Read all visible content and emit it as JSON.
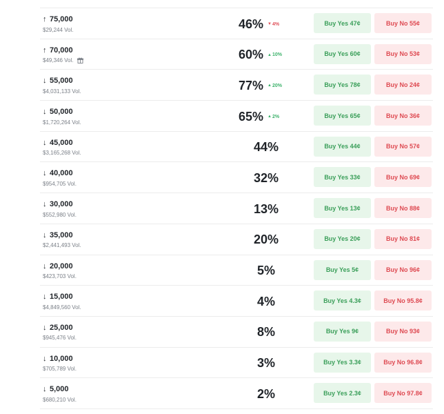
{
  "markets": [
    {
      "direction": "up",
      "label": "75,000",
      "volume": "$29,244 Vol.",
      "chance": "46%",
      "change": {
        "dir": "down",
        "value": "4%"
      },
      "yes": "Buy Yes 47¢",
      "no": "Buy No 55¢",
      "gift": false
    },
    {
      "direction": "up",
      "label": "70,000",
      "volume": "$49,346 Vol.",
      "chance": "60%",
      "change": {
        "dir": "up",
        "value": "10%"
      },
      "yes": "Buy Yes 60¢",
      "no": "Buy No 53¢",
      "gift": true
    },
    {
      "direction": "down",
      "label": "55,000",
      "volume": "$4,031,133 Vol.",
      "chance": "77%",
      "change": {
        "dir": "up",
        "value": "20%"
      },
      "yes": "Buy Yes 78¢",
      "no": "Buy No 24¢",
      "gift": false
    },
    {
      "direction": "down",
      "label": "50,000",
      "volume": "$1,720,264 Vol.",
      "chance": "65%",
      "change": {
        "dir": "up",
        "value": "2%"
      },
      "yes": "Buy Yes 65¢",
      "no": "Buy No 36¢",
      "gift": false
    },
    {
      "direction": "down",
      "label": "45,000",
      "volume": "$3,165,268 Vol.",
      "chance": "44%",
      "change": null,
      "yes": "Buy Yes 44¢",
      "no": "Buy No 57¢",
      "gift": false
    },
    {
      "direction": "down",
      "label": "40,000",
      "volume": "$954,705 Vol.",
      "chance": "32%",
      "change": null,
      "yes": "Buy Yes 33¢",
      "no": "Buy No 69¢",
      "gift": false
    },
    {
      "direction": "down",
      "label": "30,000",
      "volume": "$552,980 Vol.",
      "chance": "13%",
      "change": null,
      "yes": "Buy Yes 13¢",
      "no": "Buy No 88¢",
      "gift": false
    },
    {
      "direction": "down",
      "label": "35,000",
      "volume": "$2,441,493 Vol.",
      "chance": "20%",
      "change": null,
      "yes": "Buy Yes 20¢",
      "no": "Buy No 81¢",
      "gift": false
    },
    {
      "direction": "down",
      "label": "20,000",
      "volume": "$423,703 Vol.",
      "chance": "5%",
      "change": null,
      "yes": "Buy Yes 5¢",
      "no": "Buy No 96¢",
      "gift": false
    },
    {
      "direction": "down",
      "label": "15,000",
      "volume": "$4,849,560 Vol.",
      "chance": "4%",
      "change": null,
      "yes": "Buy Yes 4.3¢",
      "no": "Buy No 95.8¢",
      "gift": false
    },
    {
      "direction": "down",
      "label": "25,000",
      "volume": "$945,476 Vol.",
      "chance": "8%",
      "change": null,
      "yes": "Buy Yes 9¢",
      "no": "Buy No 93¢",
      "gift": false
    },
    {
      "direction": "down",
      "label": "10,000",
      "volume": "$705,789 Vol.",
      "chance": "3%",
      "change": null,
      "yes": "Buy Yes 3.3¢",
      "no": "Buy No 96.8¢",
      "gift": false
    },
    {
      "direction": "down",
      "label": "5,000",
      "volume": "$680,210 Vol.",
      "chance": "2%",
      "change": null,
      "yes": "Buy Yes 2.3¢",
      "no": "Buy No 97.8¢",
      "gift": false
    }
  ],
  "icons": {
    "up": "arrow-up-icon",
    "down": "arrow-down-icon",
    "gift": "gift-icon",
    "change_up": "triangle-up-icon",
    "change_down": "triangle-down-icon"
  },
  "colors": {
    "yes_bg": "#e7f6ea",
    "yes_text": "#3b9f5a",
    "no_bg": "#fde9ea",
    "no_text": "#de4a52",
    "up": "#3db26b",
    "down": "#e0525a"
  }
}
